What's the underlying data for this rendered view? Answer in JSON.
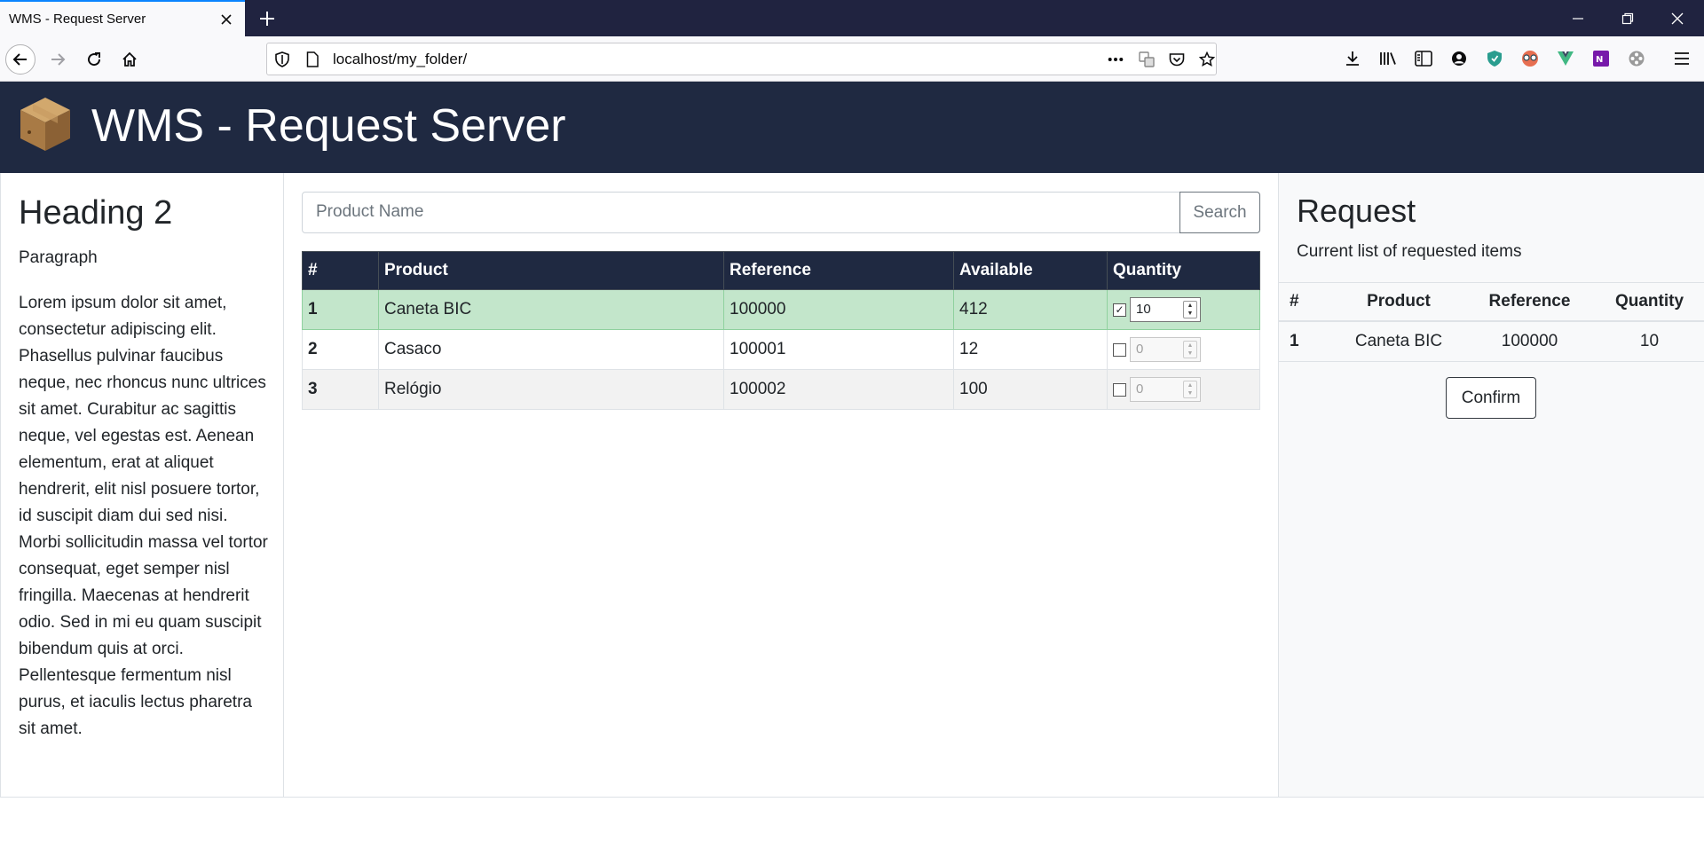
{
  "browser": {
    "tab_title": "WMS - Request Server",
    "url": "localhost/my_folder/"
  },
  "header": {
    "title": "WMS - Request Server",
    "logo_icon": "box-icon"
  },
  "sidebar": {
    "heading": "Heading 2",
    "paragraph": "Paragraph",
    "lorem": "Lorem ipsum dolor sit amet, consectetur adipiscing elit. Phasellus pulvinar faucibus neque, nec rhoncus nunc ultrices sit amet. Curabitur ac sagittis neque, vel egestas est. Aenean elementum, erat at aliquet hendrerit, elit nisl posuere tortor, id suscipit diam dui sed nisi. Morbi sollicitudin massa vel tortor consequat, eget semper nisl fringilla. Maecenas at hendrerit odio. Sed in mi eu quam suscipit bibendum quis at orci. Pellentesque fermentum nisl purus, et iaculis lectus pharetra sit amet."
  },
  "search": {
    "placeholder": "Product Name",
    "button_label": "Search"
  },
  "products": {
    "headers": [
      "#",
      "Product",
      "Reference",
      "Available",
      "Quantity"
    ],
    "rows": [
      {
        "id": "1",
        "product": "Caneta BIC",
        "reference": "100000",
        "available": "412",
        "checked": true,
        "quantity": "10"
      },
      {
        "id": "2",
        "product": "Casaco",
        "reference": "100001",
        "available": "12",
        "checked": false,
        "quantity": "0"
      },
      {
        "id": "3",
        "product": "Relógio",
        "reference": "100002",
        "available": "100",
        "checked": false,
        "quantity": "0"
      }
    ]
  },
  "request": {
    "title": "Request",
    "subtitle": "Current list of requested items",
    "headers": [
      "#",
      "Product",
      "Reference",
      "Quantity"
    ],
    "rows": [
      {
        "id": "1",
        "product": "Caneta BIC",
        "reference": "100000",
        "quantity": "10"
      }
    ],
    "confirm_label": "Confirm"
  },
  "colors": {
    "header_bg": "#1f2941",
    "selected_row": "#c3e6cb",
    "tab_accent": "#0a84ff"
  }
}
